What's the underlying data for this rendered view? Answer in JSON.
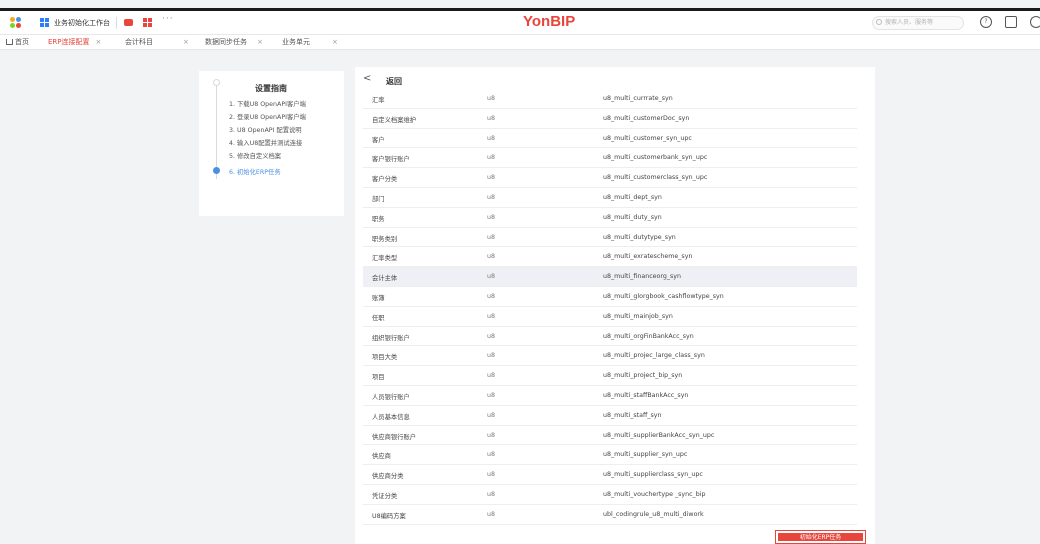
{
  "topbar": {
    "workbench": "业务初始化工作台",
    "more": "···",
    "brand": "YonBIP",
    "search_placeholder": "搜索人员、服务等",
    "icon_names": [
      "app-grid-icon",
      "red-app-icon",
      "grid-icon",
      "more-icon",
      "help-icon",
      "message-icon"
    ]
  },
  "tabs": [
    {
      "label": "首页",
      "closable": false,
      "active": false
    },
    {
      "label": "ERP连接配置",
      "closable": true,
      "active": true
    },
    {
      "label": "会计科目",
      "closable": true,
      "active": false
    },
    {
      "label": "数据同步任务",
      "closable": true,
      "active": false
    },
    {
      "label": "业务单元",
      "closable": true,
      "active": false
    }
  ],
  "close_glyph": "×",
  "guide": {
    "title": "设置指南",
    "steps": [
      "1.  下载U8 OpenAPI客户端",
      "2.  登录U8 OpenAPI客户端",
      "3.  U8 OpenAPI 配置说明",
      "4.  输入U8配置并测试连接",
      "5.  修改自定义档案",
      "6.  初始化ERP任务"
    ],
    "active_step": 5
  },
  "panel": {
    "back_label": "返回",
    "rows": [
      {
        "name": "汇率",
        "source": "u8",
        "task": "u8_multi_currrate_syn"
      },
      {
        "name": "自定义档案维护",
        "source": "u8",
        "task": "u8_multi_customerDoc_syn"
      },
      {
        "name": "客户",
        "source": "u8",
        "task": "u8_multi_customer_syn_upc"
      },
      {
        "name": "客户银行账户",
        "source": "u8",
        "task": "u8_multi_customerbank_syn_upc"
      },
      {
        "name": "客户分类",
        "source": "u8",
        "task": "u8_multi_customerclass_syn_upc"
      },
      {
        "name": "部门",
        "source": "u8",
        "task": "u8_multi_dept_syn"
      },
      {
        "name": "职务",
        "source": "u8",
        "task": "u8_multi_duty_syn"
      },
      {
        "name": "职务类别",
        "source": "u8",
        "task": "u8_multi_dutytype_syn"
      },
      {
        "name": "汇率类型",
        "source": "u8",
        "task": "u8_multi_exratescheme_syn"
      },
      {
        "name": "会计主体",
        "source": "u8",
        "task": "u8_multi_financeorg_syn"
      },
      {
        "name": "账簿",
        "source": "u8",
        "task": "u8_multi_glorgbook_cashflowtype_syn"
      },
      {
        "name": "任职",
        "source": "u8",
        "task": "u8_multi_mainjob_syn"
      },
      {
        "name": "组织银行账户",
        "source": "u8",
        "task": "u8_multi_orgFinBankAcc_syn"
      },
      {
        "name": "项目大类",
        "source": "u8",
        "task": "u8_multi_projec_large_class_syn"
      },
      {
        "name": "项目",
        "source": "u8",
        "task": "u8_multi_project_bip_syn"
      },
      {
        "name": "人员银行账户",
        "source": "u8",
        "task": "u8_multi_staffBankAcc_syn"
      },
      {
        "name": "人员基本信息",
        "source": "u8",
        "task": "u8_multi_staff_syn"
      },
      {
        "name": "供应商银行账户",
        "source": "u8",
        "task": "u8_multi_supplierBankAcc_syn_upc"
      },
      {
        "name": "供应商",
        "source": "u8",
        "task": "u8_multi_supplier_syn_upc"
      },
      {
        "name": "供应商分类",
        "source": "u8",
        "task": "u8_multi_supplierclass_syn_upc"
      },
      {
        "name": "凭证分类",
        "source": "u8",
        "task": "u8_multi_vouchertype _sync_bip"
      },
      {
        "name": "U8编码方案",
        "source": "u8",
        "task": "ubl_codingrule_u8_multi_diwork"
      }
    ],
    "highlighted_row": 9,
    "init_button": "初始化ERP任务"
  },
  "colors": {
    "brand": "#e8453c",
    "accent": "#4a90e2",
    "highlight_row": "#eef0f5"
  }
}
